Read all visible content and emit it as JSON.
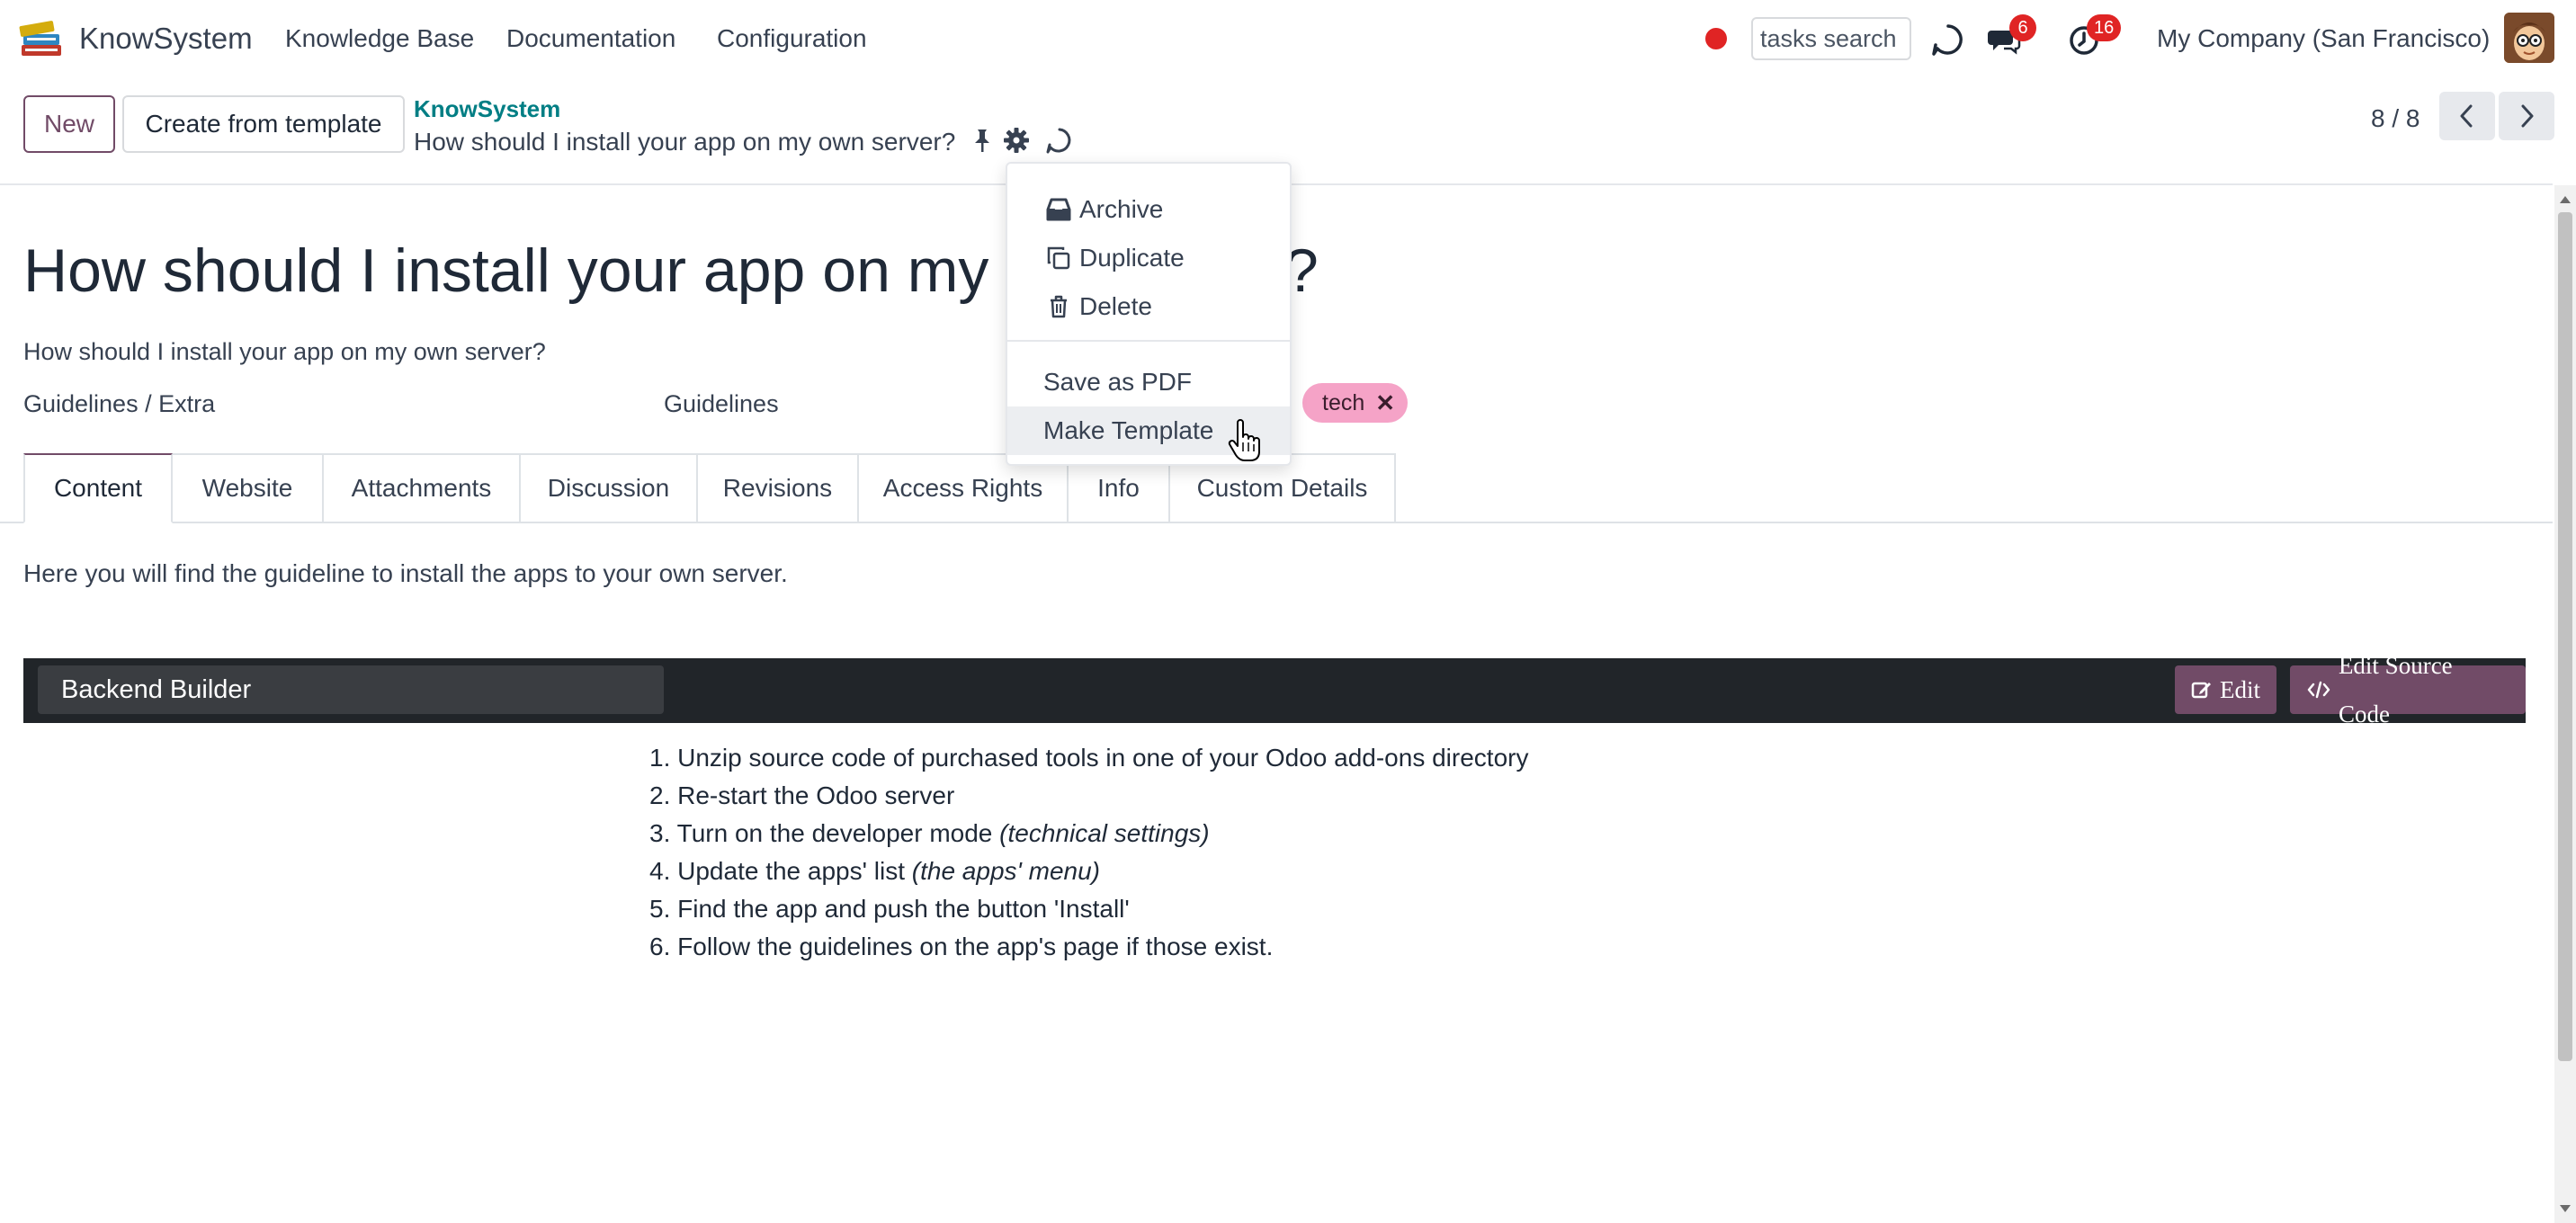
{
  "navbar": {
    "brand": "KnowSystem",
    "menus": [
      "Knowledge Base",
      "Documentation",
      "Configuration"
    ],
    "tasks_search_placeholder": "tasks search",
    "discuss_badge": "6",
    "activity_badge": "16",
    "company": "My Company (San Francisco)",
    "record_color": "#e02424"
  },
  "control_panel": {
    "new_label": "New",
    "create_template_label": "Create from template",
    "breadcrumb_parent": "KnowSystem",
    "breadcrumb_current": "How should I install your app on my own server?",
    "pager": "8 / 8"
  },
  "form": {
    "title_visible_start": "How should I install your app on my",
    "title_visible_end": "?",
    "subtitle": "How should I install your app on my own server?",
    "section": "Guidelines / Extra",
    "type": "Guidelines",
    "tag": "tech",
    "tag_color": "#f5a3c7",
    "tabs": [
      "Content",
      "Website",
      "Attachments",
      "Discussion",
      "Revisions",
      "Access Rights",
      "Info",
      "Custom Details"
    ],
    "active_tab": "Content",
    "intro": "Here you will find the guideline to install the apps to your own server.",
    "builder": {
      "name": "Backend Builder",
      "edit_label": "Edit",
      "edit_source_label": "Edit Source Code"
    },
    "steps": [
      {
        "num": "1.",
        "text": "Unzip source code of purchased tools in one of your Odoo add-ons directory",
        "note": ""
      },
      {
        "num": "2.",
        "text": "Re-start the Odoo server",
        "note": ""
      },
      {
        "num": "3.",
        "text": "Turn on the developer mode ",
        "note": "(technical settings)"
      },
      {
        "num": "4.",
        "text": "Update the apps' list ",
        "note": "(the apps' menu)"
      },
      {
        "num": "5.",
        "text": "Find the app and push the button 'Install'",
        "note": ""
      },
      {
        "num": "6.",
        "text": "Follow the guidelines on the app's page if those exist.",
        "note": ""
      }
    ]
  },
  "dropdown": {
    "items": [
      {
        "label": "Archive",
        "icon": "archive-icon"
      },
      {
        "label": "Duplicate",
        "icon": "duplicate-icon"
      },
      {
        "label": "Delete",
        "icon": "trash-icon"
      }
    ],
    "save_pdf": "Save as PDF",
    "make_template": "Make Template"
  },
  "colors": {
    "primary": "#714B67",
    "link": "#017e84",
    "badge": "#e02424",
    "builder_bar": "#212529"
  }
}
